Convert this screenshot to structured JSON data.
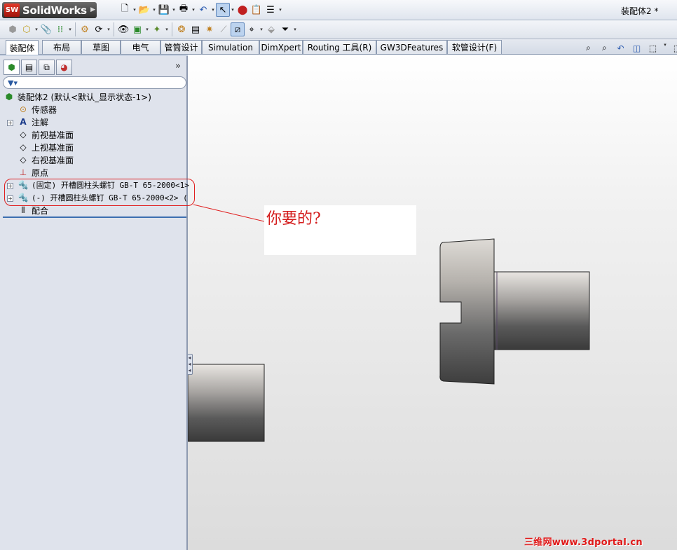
{
  "app": {
    "brand_badge": "SW",
    "brand_name": "SolidWorks",
    "document_title": "装配体2 *"
  },
  "command_tabs": [
    {
      "label": "装配体",
      "active": true
    },
    {
      "label": "布局"
    },
    {
      "label": "草图"
    },
    {
      "label": "电气"
    },
    {
      "label": "管筒设计"
    },
    {
      "label": "Simulation"
    },
    {
      "label": "DimXpert"
    },
    {
      "label": "Routing 工具(R)"
    },
    {
      "label": "GW3DFeatures"
    },
    {
      "label": "软管设计(F)"
    }
  ],
  "panel": {
    "expand_glyph": "»",
    "filter_glyph": "▼▾",
    "tree": [
      {
        "label": "装配体2  (默认<默认_显示状态-1>)",
        "icon": "assembly-icon"
      },
      {
        "label": "传感器",
        "icon": "sensor-icon"
      },
      {
        "label": "注解",
        "icon": "annotation-icon",
        "expandable": true
      },
      {
        "label": "前视基准面",
        "icon": "plane-icon"
      },
      {
        "label": "上视基准面",
        "icon": "plane-icon"
      },
      {
        "label": "右视基准面",
        "icon": "plane-icon"
      },
      {
        "label": "原点",
        "icon": "origin-icon"
      },
      {
        "label": "(固定) 开槽圆柱头螺钉 GB-T 65-2000<1>",
        "icon": "part-icon",
        "expandable": true
      },
      {
        "label": "(-) 开槽圆柱头螺钉 GB-T 65-2000<2> (",
        "icon": "part-icon",
        "expandable": true
      },
      {
        "label": "配合",
        "icon": "mates-icon"
      }
    ]
  },
  "annotation": {
    "callout_text": "你要的?"
  },
  "watermark": {
    "text": "三维网www.3dportal.cn"
  },
  "colors": {
    "highlight": "#e02020",
    "watermark": "#e01818"
  }
}
